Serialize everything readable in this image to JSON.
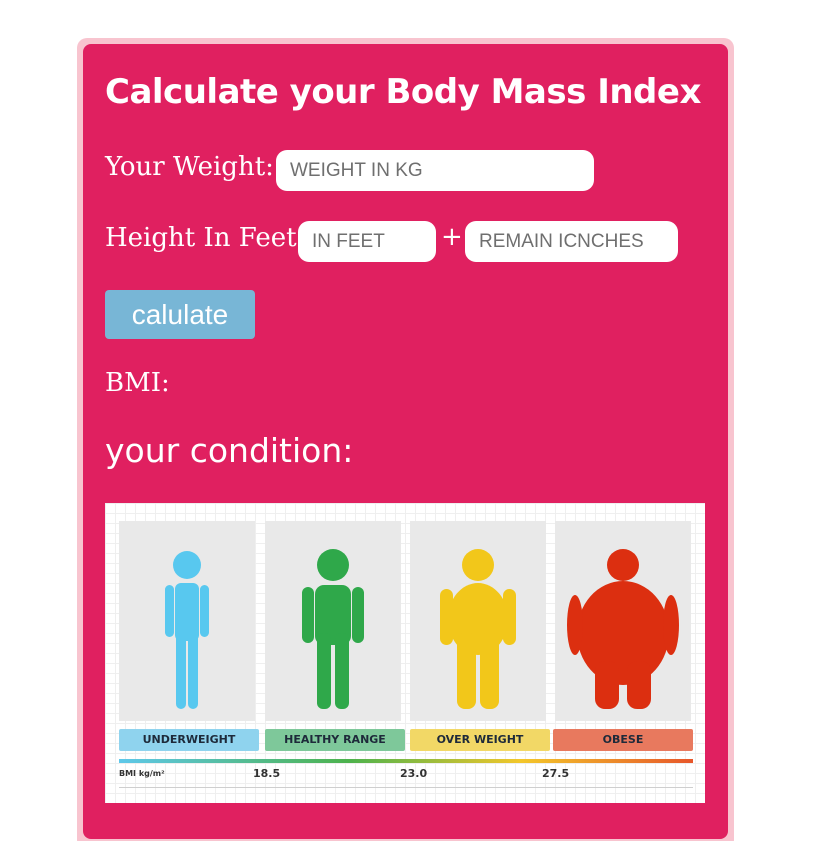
{
  "header": {
    "title": "Calculate your Body Mass Index"
  },
  "form": {
    "weight_label": "Your Weight:",
    "weight_placeholder": "WEIGHT IN KG",
    "height_label": "Height In Feet:",
    "feet_placeholder": "IN FEET",
    "plus_sign": "+",
    "inches_placeholder": "REMAIN ICNCHES",
    "calculate_label": "calulate"
  },
  "result": {
    "bmi_label": "BMI:",
    "condition_label": "your condition:"
  },
  "bmi_chart": {
    "categories": [
      {
        "label": "UNDERWEIGHT",
        "figure_color": "#58c8ef",
        "label_bg": "#8fd3ee",
        "icon": "person-slim-icon"
      },
      {
        "label": "HEALTHY RANGE",
        "figure_color": "#2fa84a",
        "label_bg": "#7ec89a",
        "icon": "person-healthy-icon"
      },
      {
        "label": "OVER WEIGHT",
        "figure_color": "#f2c71a",
        "label_bg": "#f2d866",
        "icon": "person-overweight-icon"
      },
      {
        "label": "OBESE",
        "figure_color": "#dc2f10",
        "label_bg": "#e8795e",
        "icon": "person-obese-icon"
      }
    ],
    "scale_unit": "BMI kg/m²",
    "thresholds": [
      "18.5",
      "23.0",
      "27.5"
    ]
  },
  "colors": {
    "card_bg": "#e02060",
    "card_border": "#f8c4cf",
    "button_bg": "#78b6d6"
  }
}
